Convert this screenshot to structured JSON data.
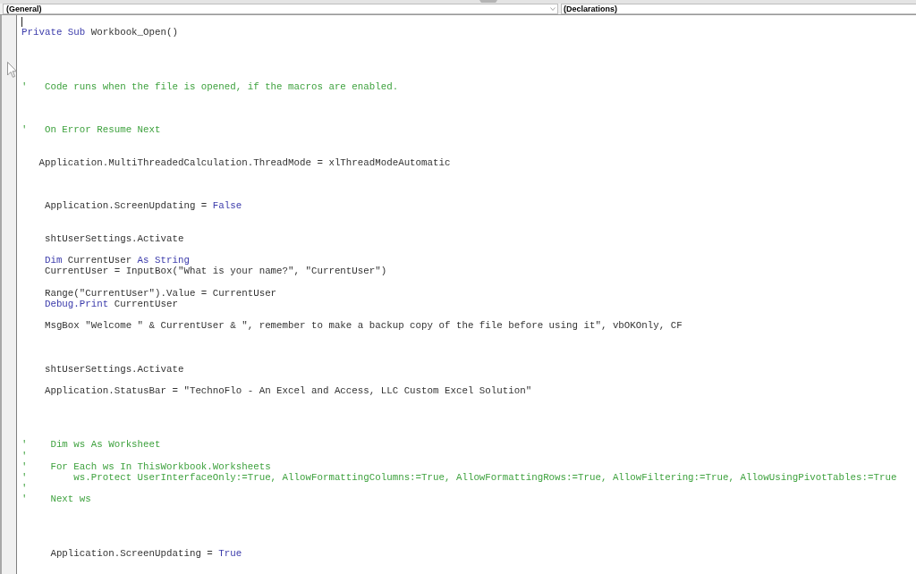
{
  "toolbar": {
    "object_list": {
      "value": "(General)"
    },
    "procedure_list": {
      "value": "(Declarations)"
    }
  },
  "code_editor": {
    "lines": [
      {
        "kind": "cursor"
      },
      {
        "kind": "code",
        "segments": [
          {
            "kind": "keyword",
            "text": "Private Sub "
          },
          {
            "kind": "plain",
            "text": "Workbook_Open()"
          }
        ]
      },
      {
        "kind": "blank"
      },
      {
        "kind": "blank"
      },
      {
        "kind": "blank"
      },
      {
        "kind": "blank"
      },
      {
        "kind": "comment",
        "text": "'   Code runs when the file is opened, if the macros are enabled."
      },
      {
        "kind": "blank"
      },
      {
        "kind": "blank"
      },
      {
        "kind": "blank"
      },
      {
        "kind": "comment",
        "text": "'   On Error Resume Next"
      },
      {
        "kind": "blank"
      },
      {
        "kind": "blank"
      },
      {
        "kind": "code",
        "segments": [
          {
            "kind": "plain",
            "text": "   Application.MultiThreadedCalculation.ThreadMode = xlThreadModeAutomatic"
          }
        ]
      },
      {
        "kind": "blank"
      },
      {
        "kind": "blank"
      },
      {
        "kind": "blank"
      },
      {
        "kind": "code",
        "segments": [
          {
            "kind": "plain",
            "text": "    Application.ScreenUpdating = "
          },
          {
            "kind": "keyword",
            "text": "False"
          }
        ]
      },
      {
        "kind": "blank"
      },
      {
        "kind": "blank"
      },
      {
        "kind": "code",
        "segments": [
          {
            "kind": "plain",
            "text": "    shtUserSettings.Activate"
          }
        ]
      },
      {
        "kind": "blank"
      },
      {
        "kind": "code",
        "segments": [
          {
            "kind": "keyword",
            "text": "    Dim "
          },
          {
            "kind": "plain",
            "text": "CurrentUser "
          },
          {
            "kind": "keyword",
            "text": "As String"
          }
        ]
      },
      {
        "kind": "code",
        "segments": [
          {
            "kind": "plain",
            "text": "    CurrentUser = InputBox(\"What is your name?\", \"CurrentUser\")"
          }
        ]
      },
      {
        "kind": "blank"
      },
      {
        "kind": "code",
        "segments": [
          {
            "kind": "plain",
            "text": "    Range(\"CurrentUser\").Value = CurrentUser"
          }
        ]
      },
      {
        "kind": "code",
        "segments": [
          {
            "kind": "keyword",
            "text": "    Debug.Print "
          },
          {
            "kind": "plain",
            "text": "CurrentUser"
          }
        ]
      },
      {
        "kind": "blank"
      },
      {
        "kind": "code",
        "segments": [
          {
            "kind": "plain",
            "text": "    MsgBox \"Welcome \" & CurrentUser & \", remember to make a backup copy of the file before using it\", vbOKOnly, CF"
          }
        ]
      },
      {
        "kind": "blank"
      },
      {
        "kind": "blank"
      },
      {
        "kind": "blank"
      },
      {
        "kind": "code",
        "segments": [
          {
            "kind": "plain",
            "text": "    shtUserSettings.Activate"
          }
        ]
      },
      {
        "kind": "blank"
      },
      {
        "kind": "code",
        "segments": [
          {
            "kind": "plain",
            "text": "    Application.StatusBar = \"TechnoFlo - An Excel and Access, LLC Custom Excel Solution\""
          }
        ]
      },
      {
        "kind": "blank"
      },
      {
        "kind": "blank"
      },
      {
        "kind": "blank"
      },
      {
        "kind": "blank"
      },
      {
        "kind": "comment",
        "text": "'    Dim ws As Worksheet"
      },
      {
        "kind": "comment",
        "text": "'"
      },
      {
        "kind": "comment",
        "text": "'    For Each ws In ThisWorkbook.Worksheets"
      },
      {
        "kind": "comment",
        "text": "'        ws.Protect UserInterfaceOnly:=True, AllowFormattingColumns:=True, AllowFormattingRows:=True, AllowFiltering:=True, AllowUsingPivotTables:=True"
      },
      {
        "kind": "comment",
        "text": "'"
      },
      {
        "kind": "comment",
        "text": "'    Next ws"
      },
      {
        "kind": "blank"
      },
      {
        "kind": "blank"
      },
      {
        "kind": "blank"
      },
      {
        "kind": "blank"
      },
      {
        "kind": "code",
        "segments": [
          {
            "kind": "plain",
            "text": "     Application.ScreenUpdating = "
          },
          {
            "kind": "keyword",
            "text": "True"
          }
        ]
      }
    ]
  }
}
